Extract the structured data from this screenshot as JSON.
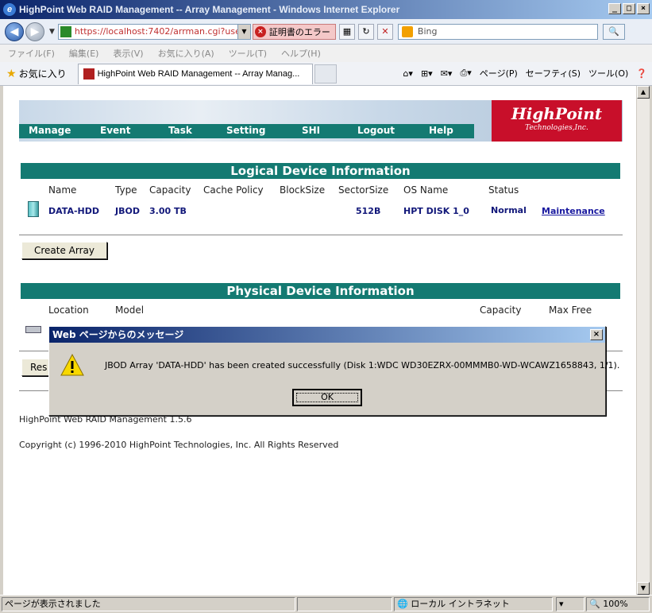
{
  "window": {
    "title": "HighPoint Web RAID Management -- Array Management - Windows Internet Explorer",
    "controls": [
      "_",
      "□",
      "×"
    ]
  },
  "address": {
    "url": "https://localhost:7402/arrman.cgi?useri",
    "cert_error": "証明書のエラー",
    "search_placeholder": "Bing"
  },
  "menu": [
    "ファイル(F)",
    "編集(E)",
    "表示(V)",
    "お気に入り(A)",
    "ツール(T)",
    "ヘルプ(H)"
  ],
  "favbar": {
    "favorites_label": "お気に入り",
    "tab_title": "HighPoint Web RAID Management -- Array Manag...",
    "commands": [
      "ページ(P)",
      "セーフティ(S)",
      "ツール(O)"
    ]
  },
  "nav": [
    "Manage",
    "Event",
    "Task",
    "Setting",
    "SHI",
    "Logout",
    "Help"
  ],
  "logo": {
    "line1": "HighPoint",
    "line2": "Technologies,Inc."
  },
  "logical": {
    "header": "Logical Device Information",
    "columns": [
      "Name",
      "Type",
      "Capacity",
      "Cache Policy",
      "BlockSize",
      "SectorSize",
      "OS Name",
      "Status"
    ],
    "row": {
      "name": "DATA-HDD",
      "type": "JBOD",
      "capacity": "3.00 TB",
      "sector_size": "512B",
      "os_name": "HPT DISK 1_0",
      "status": "Normal",
      "action": "Maintenance"
    }
  },
  "create_array_label": "Create Array",
  "physical": {
    "header": "Physical Device Information",
    "columns": [
      "Location",
      "Model",
      "Capacity",
      "Max Free"
    ]
  },
  "rescan_label_partial": "Res",
  "footer": {
    "version": "HighPoint Web RAID Management 1.5.6",
    "copyright": "Copyright (c) 1996-2010 HighPoint Technologies, Inc. All Rights Reserved"
  },
  "dialog": {
    "title": "Web ページからのメッセージ",
    "message": "JBOD Array 'DATA-HDD' has been created successfully (Disk 1:WDC WD30EZRX-00MMMB0-WD-WCAWZ1658843, 1/1).",
    "ok_label": "OK"
  },
  "status": {
    "text": "ページが表示されました",
    "zone": "ローカル イントラネット",
    "zoom": "100%"
  }
}
